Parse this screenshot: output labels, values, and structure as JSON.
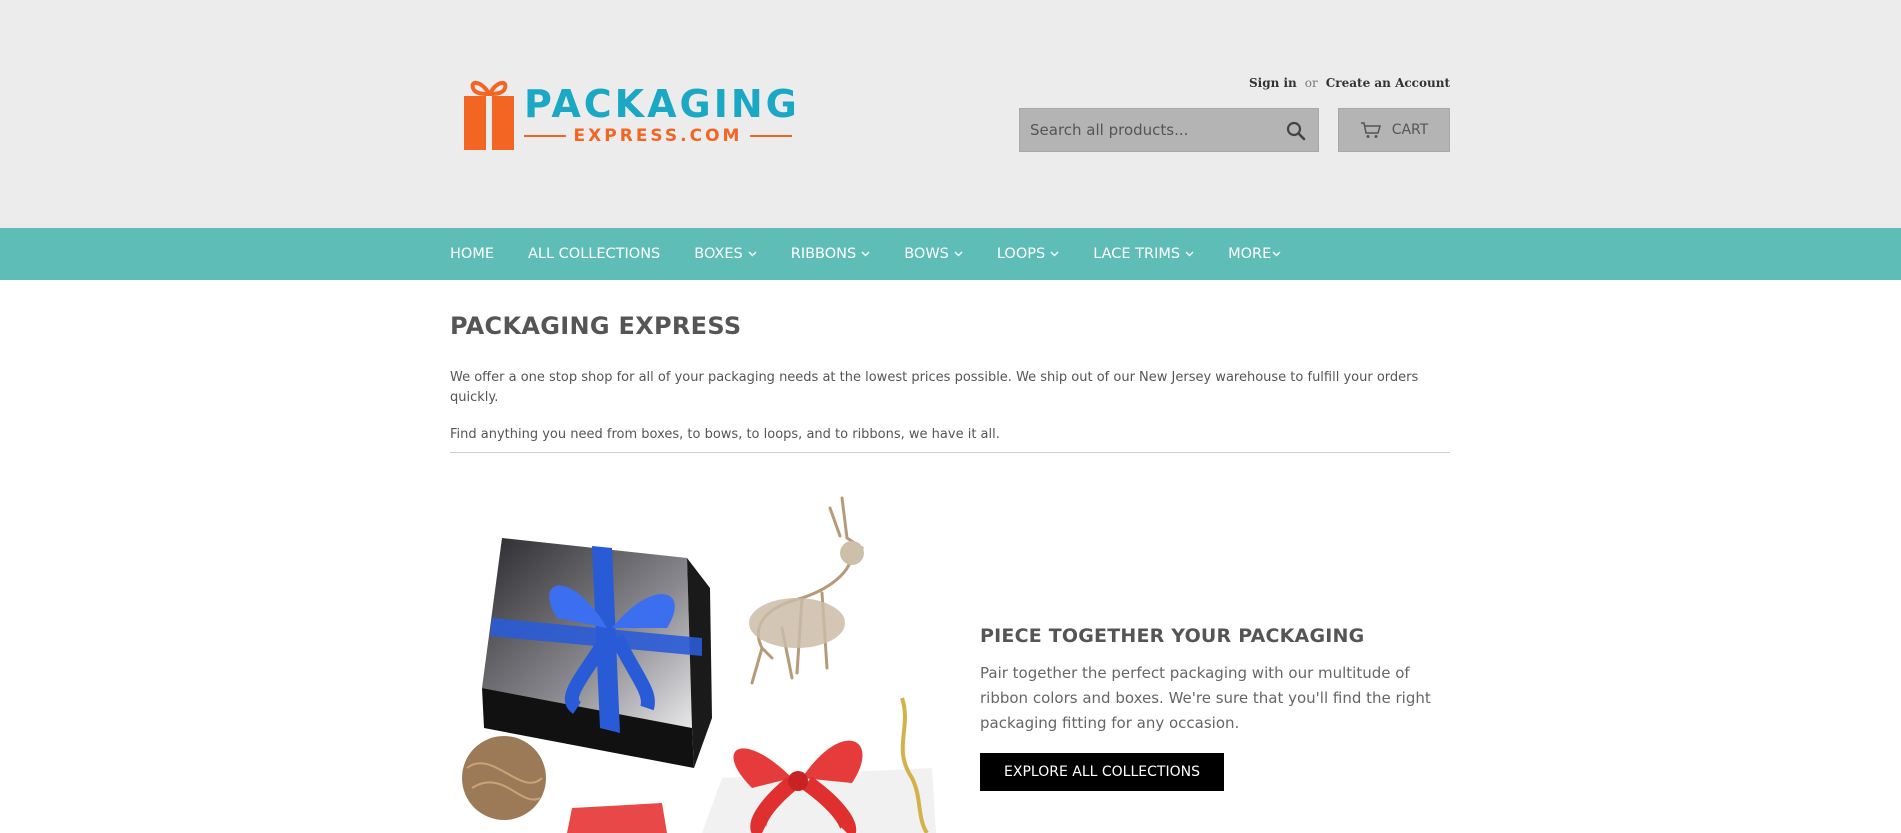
{
  "header": {
    "logo_text_top": "PACKAGING",
    "logo_text_bottom": "EXPRESS.COM",
    "sign_in": "Sign in",
    "or": "or",
    "create_account": "Create an Account",
    "search_placeholder": "Search all products...",
    "cart_label": "CART"
  },
  "nav": {
    "items": [
      {
        "label": "HOME",
        "dropdown": false
      },
      {
        "label": "ALL COLLECTIONS",
        "dropdown": false
      },
      {
        "label": "BOXES",
        "dropdown": true
      },
      {
        "label": "RIBBONS",
        "dropdown": true
      },
      {
        "label": "BOWS",
        "dropdown": true
      },
      {
        "label": "LOOPS",
        "dropdown": true
      },
      {
        "label": "LACE TRIMS",
        "dropdown": true
      },
      {
        "label": "MORE",
        "dropdown": true
      }
    ]
  },
  "main": {
    "title": "PACKAGING EXPRESS",
    "paragraphs": [
      "We offer a one stop shop for all of your packaging needs at the lowest prices possible. We ship out of our New Jersey warehouse to fulfill your orders quickly.",
      "Find anything you need from boxes, to bows, to loops, and to ribbons, we have it all."
    ],
    "feature": {
      "heading": "PIECE TOGETHER YOUR PACKAGING",
      "text": "Pair together the perfect packaging with our multitude of ribbon colors and boxes. We're sure that you'll find the right packaging fitting for any occasion.",
      "button": "EXPLORE ALL COLLECTIONS"
    }
  },
  "colors": {
    "header_bg": "#ececec",
    "nav_bg": "#5fbdb8",
    "logo_blue": "#1ba8c4",
    "logo_orange": "#f26522",
    "button_bg": "#000000"
  }
}
